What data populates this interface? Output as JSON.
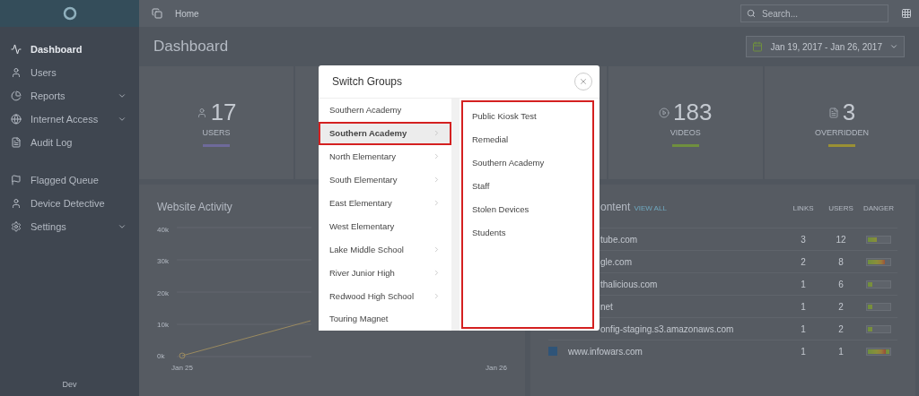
{
  "sidebar": {
    "sections": [
      {
        "items": [
          {
            "label": "Dashboard",
            "selected": true,
            "expandable": false
          },
          {
            "label": "Users",
            "selected": false,
            "expandable": false
          },
          {
            "label": "Reports",
            "selected": false,
            "expandable": true
          },
          {
            "label": "Internet Access",
            "selected": false,
            "expandable": true
          },
          {
            "label": "Audit Log",
            "selected": false,
            "expandable": false
          }
        ]
      },
      {
        "items": [
          {
            "label": "Flagged Queue",
            "selected": false,
            "expandable": false
          },
          {
            "label": "Device Detective",
            "selected": false,
            "expandable": false
          },
          {
            "label": "Settings",
            "selected": false,
            "expandable": true
          }
        ]
      }
    ],
    "footer": "Dev"
  },
  "topbar": {
    "breadcrumb": "Home",
    "search": {
      "placeholder": "Search..."
    }
  },
  "page": {
    "title": "Dashboard",
    "date_range": "Jan 19, 2017 - Jan 26, 2017"
  },
  "stats": [
    {
      "value": "17",
      "label": "USERS",
      "color": "#6e6a9a"
    },
    {
      "value": "183",
      "label": "VIDEOS",
      "color": "#6f8f3e"
    },
    {
      "value": "3",
      "label": "OVERRIDDEN",
      "color": "#9a9034"
    }
  ],
  "activity": {
    "title": "Website Activity",
    "y_labels": [
      "40k",
      "30k",
      "20k",
      "10k",
      "0k"
    ],
    "x_labels": [
      "Jan 25",
      "Jan 26"
    ]
  },
  "content": {
    "title": "ontent",
    "link": "VIEW ALL",
    "columns": [
      "LINKS",
      "USERS",
      "DANGER"
    ],
    "rows": [
      {
        "name": "tube.com",
        "covered": true,
        "links": "3",
        "users": "12",
        "level": 0.4
      },
      {
        "name": "gle.com",
        "covered": true,
        "links": "2",
        "users": "8",
        "level": 0.8
      },
      {
        "name": "thalicious.com",
        "covered": true,
        "links": "1",
        "users": "6",
        "level": 0.2
      },
      {
        "name": "net",
        "covered": true,
        "links": "1",
        "users": "2",
        "level": 0.2
      },
      {
        "name": "onfig-staging.s3.amazonaws.com",
        "covered": true,
        "links": "1",
        "users": "2",
        "level": 0.2
      },
      {
        "name": "www.infowars.com",
        "covered": false,
        "links": "1",
        "users": "1",
        "level": 1
      }
    ]
  },
  "modal": {
    "title": "Switch Groups",
    "groups": [
      {
        "label": "Southern Academy",
        "selected": false,
        "has_children": false
      },
      {
        "label": "Southern Academy",
        "selected": true,
        "has_children": true
      },
      {
        "label": "North Elementary",
        "selected": false,
        "has_children": true
      },
      {
        "label": "South Elementary",
        "selected": false,
        "has_children": true
      },
      {
        "label": "East Elementary",
        "selected": false,
        "has_children": true
      },
      {
        "label": "West Elementary",
        "selected": false,
        "has_children": false
      },
      {
        "label": "Lake Middle School",
        "selected": false,
        "has_children": true
      },
      {
        "label": "River Junior High",
        "selected": false,
        "has_children": true
      },
      {
        "label": "Redwood High School",
        "selected": false,
        "has_children": true
      },
      {
        "label": "Touring Magnet",
        "selected": false,
        "has_children": false
      }
    ],
    "subgroups_highlighted": true,
    "subgroups": [
      "Public Kiosk Test",
      "Remedial",
      "Southern Academy",
      "Staff",
      "Stolen Devices",
      "Students"
    ]
  }
}
